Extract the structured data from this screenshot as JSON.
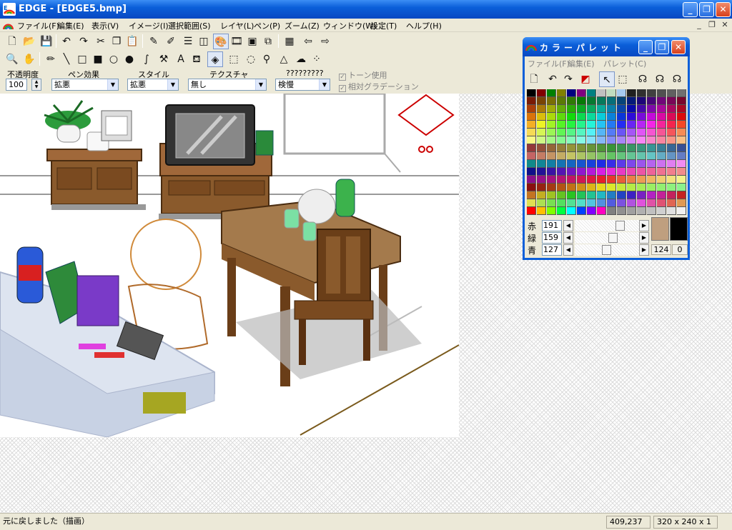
{
  "window": {
    "title": "EDGE - [EDGE5.bmp]",
    "min_glyph": "_",
    "max_glyph": "❐",
    "close_glyph": "✕"
  },
  "menu": {
    "items": [
      "ファイル(F)",
      "編集(E)",
      "表示(V)",
      "イメージ(I)",
      "選択範囲(S)",
      "レイヤ(L)",
      "ペン(P)",
      "ズーム(Z)",
      "ウィンドウ(W)",
      "設定(T)",
      "ヘルプ(H)"
    ],
    "mdi_min": "_",
    "mdi_restore": "❐",
    "mdi_close": "✕"
  },
  "toolbar1": {
    "icons": [
      "new-file-icon",
      "open-file-icon",
      "save-icon",
      "undo-icon",
      "redo-icon",
      "cut-icon",
      "copy-icon",
      "paste-icon",
      "pen-settings-icon",
      "brush-icon",
      "line-width-icon",
      "layers-icon",
      "color-palette-icon",
      "film-icon",
      "preview-icon",
      "zoom-window-icon",
      "grid-icon",
      "arrow-left-icon",
      "arrow-right-icon"
    ]
  },
  "toolbar2": {
    "icons": [
      "magnifier-icon",
      "hand-icon",
      "pencil-icon",
      "line-icon",
      "rectangle-icon",
      "filled-rectangle-icon",
      "ellipse-icon",
      "filled-ellipse-icon",
      "curve-icon",
      "hammer-icon",
      "text-icon",
      "fill-bucket-icon",
      "transparent-color-icon",
      "rect-select-icon",
      "ellipse-select-icon",
      "lasso-select-icon",
      "polygon-select-icon",
      "cloud-select-icon",
      "dot-select-icon"
    ]
  },
  "options": {
    "opacity_label": "不透明度",
    "opacity_value": "100",
    "pen_effect_label": "ペン効果",
    "pen_effect_value": "拡悪",
    "style_label": "スタイル",
    "style_value": "拡悪",
    "texture_label": "テクスチャ",
    "texture_value": "無し",
    "unknown_label": "?????????",
    "unknown_value": "検慢",
    "tone_label": "トーン使用",
    "gradation_label": "相対グラデーション"
  },
  "status": {
    "message": "元に戻しました（描画）",
    "coords": "409,237",
    "image_info": "320 x 240 x 1"
  },
  "palette": {
    "title": "カラーパレット",
    "menu": [
      "ファイル(F)",
      "編集(E)",
      "パレット(C)"
    ],
    "tools": [
      "new-palette-icon",
      "undo-icon",
      "redo-icon",
      "palette-color-icon",
      "pointer-icon",
      "select-box-icon",
      "headphones-icon",
      "headphones-icon",
      "headphones-icon"
    ],
    "red_label": "赤",
    "green_label": "緑",
    "blue_label": "青",
    "red": "191",
    "green": "159",
    "blue": "127",
    "index": "124",
    "index2": "0",
    "fg_color": "#bf9f7f",
    "bg_color": "#000000",
    "slider_levels": {
      "red": 0.75,
      "green": 0.62,
      "blue": 0.5
    }
  }
}
